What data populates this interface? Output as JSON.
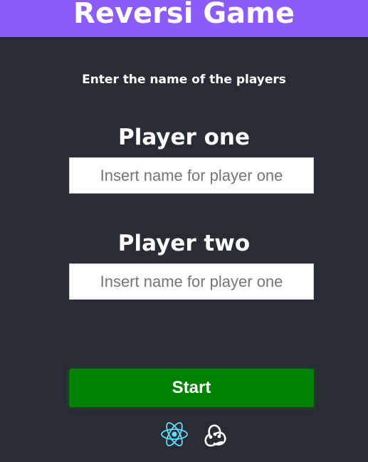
{
  "header": {
    "title": "Reversi Game",
    "color": "#8b5cf6"
  },
  "form": {
    "instruction": "Enter the name of the players",
    "player_one": {
      "heading": "Player one",
      "placeholder": "Insert name for player one",
      "value": ""
    },
    "player_two": {
      "heading": "Player two",
      "placeholder": "Insert name for player one",
      "value": ""
    },
    "start_label": "Start",
    "start_color": "#008000"
  },
  "footer": {
    "icons": [
      "react-logo-icon",
      "redux-logo-icon"
    ],
    "react_color": "#61dafb",
    "redux_color": "#ffffff"
  },
  "background_color": "#282c34"
}
